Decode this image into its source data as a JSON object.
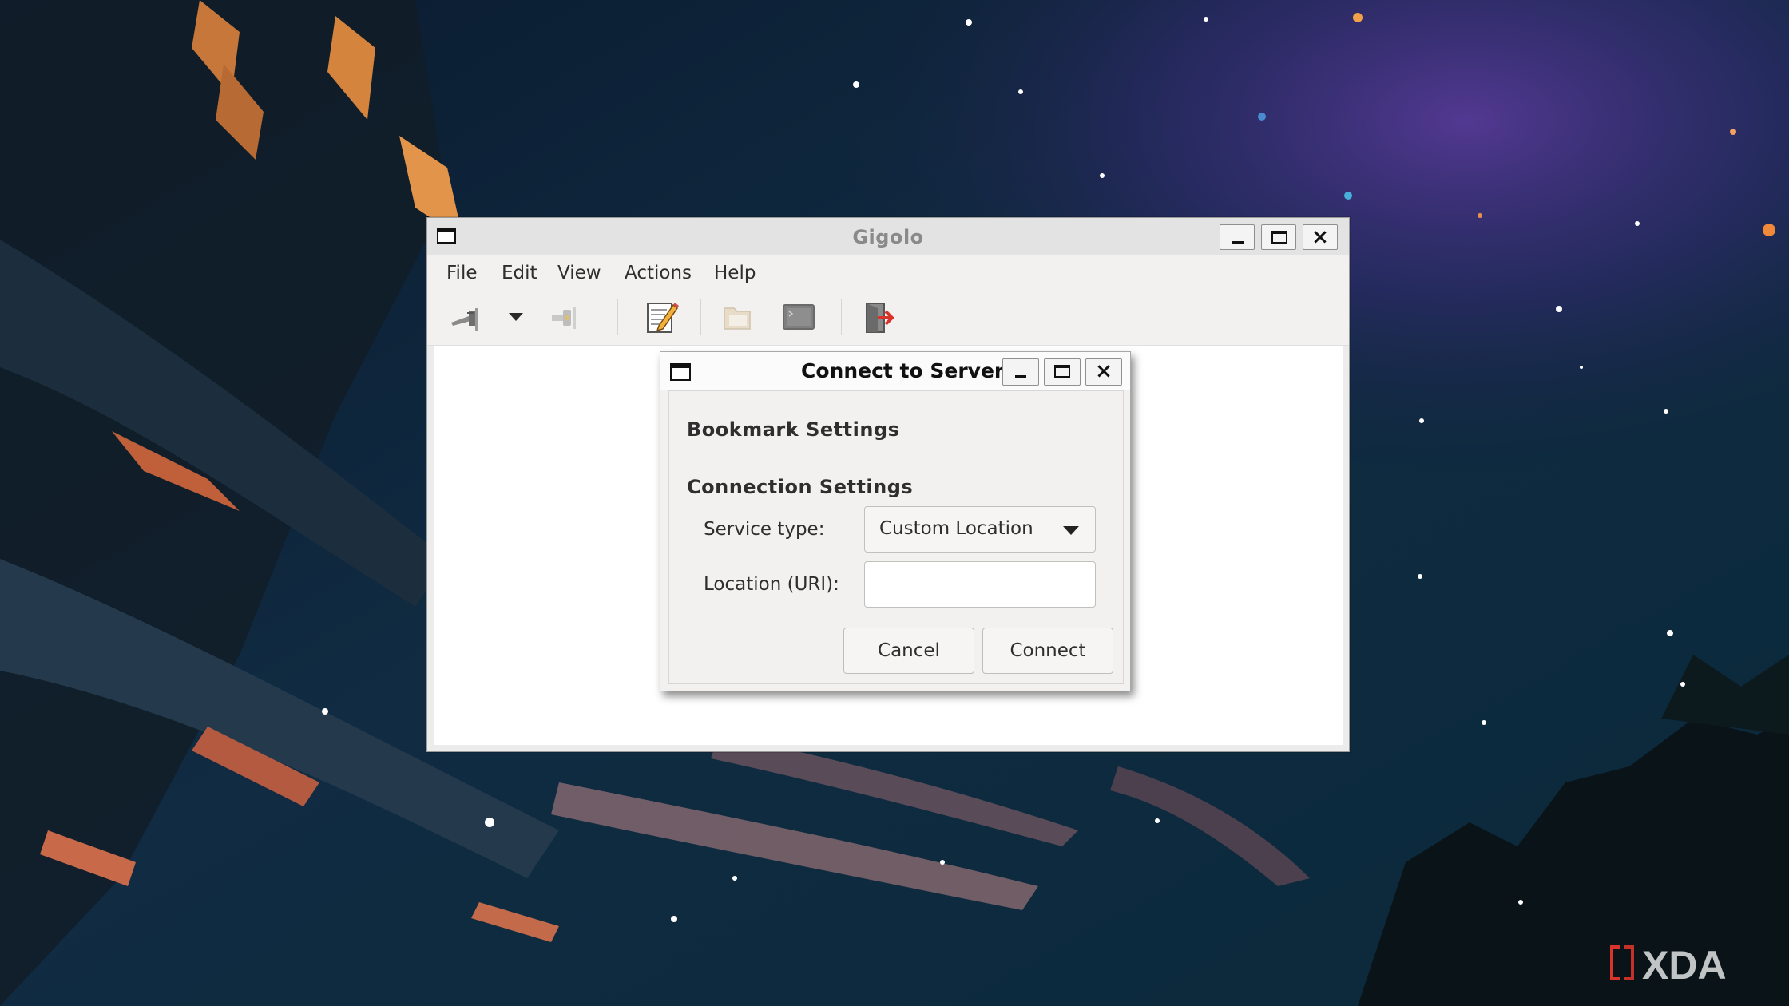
{
  "main_window": {
    "title": "Gigolo",
    "menu": [
      "File",
      "Edit",
      "View",
      "Actions",
      "Help"
    ],
    "toolbar_icons": [
      "connect-icon",
      "dropdown-arrow-icon",
      "disconnect-icon",
      "edit-bookmark-icon",
      "open-folder-icon",
      "terminal-icon",
      "quit-icon"
    ]
  },
  "dialog": {
    "title": "Connect to Server",
    "bookmark_section": "Bookmark Settings",
    "connection_section": "Connection Settings",
    "service_type_label": "Service type:",
    "service_type_value": "Custom Location",
    "location_label": "Location (URI):",
    "location_value": "",
    "cancel_label": "Cancel",
    "connect_label": "Connect"
  },
  "watermark": {
    "brand": "XDA"
  },
  "colors": {
    "accent": "#d9342b",
    "window_bg": "#f2f1f0",
    "title_text": "#8a8a8a"
  }
}
